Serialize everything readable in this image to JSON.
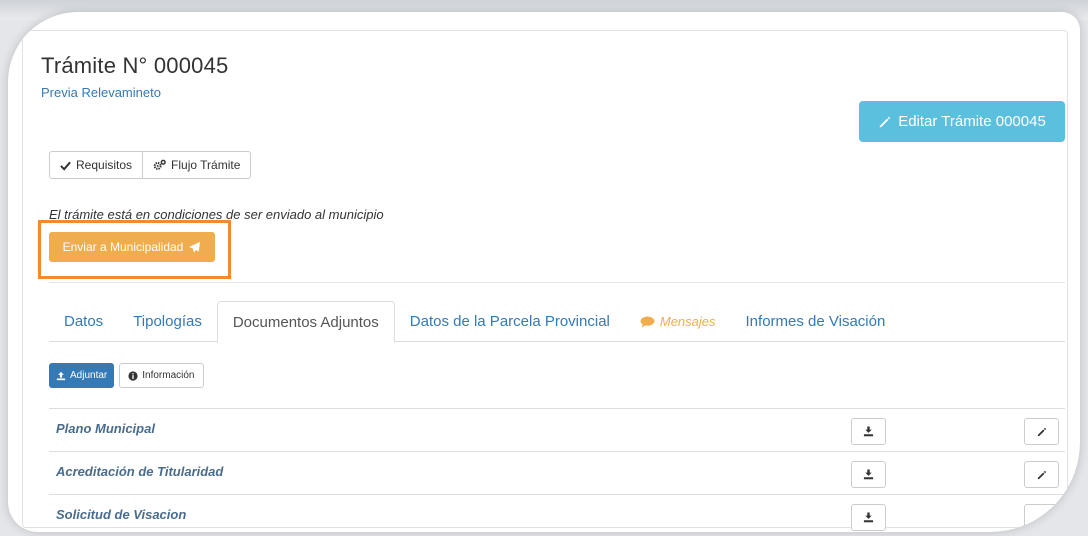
{
  "header": {
    "title": "Trámite N° 000045",
    "subtitle": "Previa Relevamineto",
    "edit_button_label": "Editar Trámite 000045"
  },
  "toolbar": {
    "requisitos_label": "Requisitos",
    "flujo_label": "Flujo Trámite"
  },
  "status": {
    "message": "El trámite está en condiciones de ser enviado al municipio",
    "send_button_label": "Enviar a Municipalidad",
    "highlight_color": "#f28b30"
  },
  "tabs": [
    {
      "label": "Datos"
    },
    {
      "label": "Tipologías"
    },
    {
      "label": "Documentos Adjuntos",
      "active": true
    },
    {
      "label": "Datos de la Parcela Provincial"
    },
    {
      "label": "Mensajes",
      "icon": "comment-icon"
    },
    {
      "label": "Informes de Visación"
    }
  ],
  "documents": {
    "attach_label": "Adjuntar",
    "info_label": "Información",
    "rows": [
      {
        "name": "Plano Municipal"
      },
      {
        "name": "Acreditación de Titularidad"
      },
      {
        "name": "Solicitud de Visacion"
      }
    ]
  },
  "colors": {
    "primary": "#337ab7",
    "info": "#5bc0de",
    "warning": "#f0ad4e"
  }
}
